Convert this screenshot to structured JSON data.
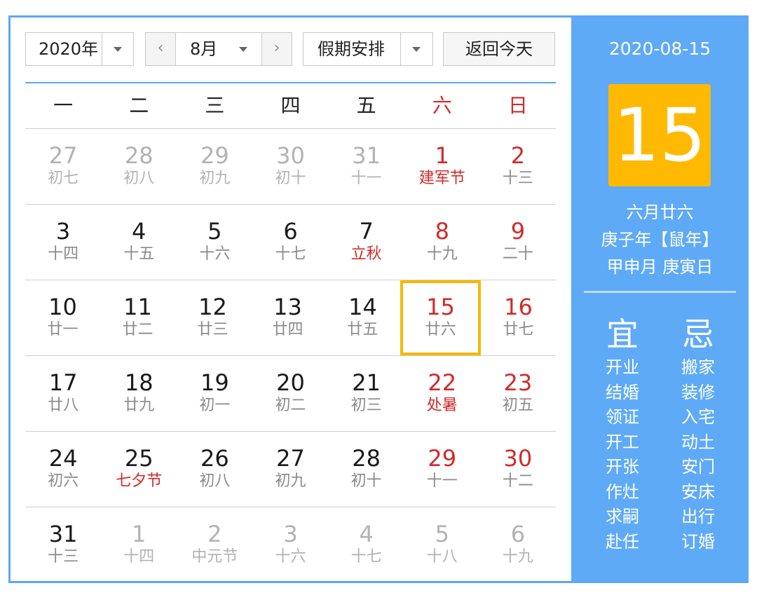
{
  "toolbar": {
    "year": "2020年",
    "prev_icon": "‹",
    "month": "8月",
    "next_icon": "›",
    "holiday": "假期安排",
    "today_button": "返回今天"
  },
  "weekdays": [
    "一",
    "二",
    "三",
    "四",
    "五",
    "六",
    "日"
  ],
  "weeks": [
    [
      {
        "day": "27",
        "lunar": "初七",
        "other": true
      },
      {
        "day": "28",
        "lunar": "初八",
        "other": true
      },
      {
        "day": "29",
        "lunar": "初九",
        "other": true
      },
      {
        "day": "30",
        "lunar": "初十",
        "other": true
      },
      {
        "day": "31",
        "lunar": "十一",
        "other": true
      },
      {
        "day": "1",
        "lunar": "建军节",
        "weekend": true,
        "festival": true
      },
      {
        "day": "2",
        "lunar": "十三",
        "weekend": true
      }
    ],
    [
      {
        "day": "3",
        "lunar": "十四"
      },
      {
        "day": "4",
        "lunar": "十五"
      },
      {
        "day": "5",
        "lunar": "十六"
      },
      {
        "day": "6",
        "lunar": "十七"
      },
      {
        "day": "7",
        "lunar": "立秋",
        "festival": true
      },
      {
        "day": "8",
        "lunar": "十九",
        "weekend": true
      },
      {
        "day": "9",
        "lunar": "二十",
        "weekend": true
      }
    ],
    [
      {
        "day": "10",
        "lunar": "廿一"
      },
      {
        "day": "11",
        "lunar": "廿二"
      },
      {
        "day": "12",
        "lunar": "廿三"
      },
      {
        "day": "13",
        "lunar": "廿四"
      },
      {
        "day": "14",
        "lunar": "廿五"
      },
      {
        "day": "15",
        "lunar": "廿六",
        "weekend": true,
        "selected": true
      },
      {
        "day": "16",
        "lunar": "廿七",
        "weekend": true
      }
    ],
    [
      {
        "day": "17",
        "lunar": "廿八"
      },
      {
        "day": "18",
        "lunar": "廿九"
      },
      {
        "day": "19",
        "lunar": "初一"
      },
      {
        "day": "20",
        "lunar": "初二"
      },
      {
        "day": "21",
        "lunar": "初三"
      },
      {
        "day": "22",
        "lunar": "处暑",
        "weekend": true,
        "festival": true
      },
      {
        "day": "23",
        "lunar": "初五",
        "weekend": true
      }
    ],
    [
      {
        "day": "24",
        "lunar": "初六"
      },
      {
        "day": "25",
        "lunar": "七夕节",
        "festival": true
      },
      {
        "day": "26",
        "lunar": "初八"
      },
      {
        "day": "27",
        "lunar": "初九"
      },
      {
        "day": "28",
        "lunar": "初十"
      },
      {
        "day": "29",
        "lunar": "十一",
        "weekend": true
      },
      {
        "day": "30",
        "lunar": "十二",
        "weekend": true
      }
    ],
    [
      {
        "day": "31",
        "lunar": "十三"
      },
      {
        "day": "1",
        "lunar": "十四",
        "other": true
      },
      {
        "day": "2",
        "lunar": "中元节",
        "other": true
      },
      {
        "day": "3",
        "lunar": "十六",
        "other": true
      },
      {
        "day": "4",
        "lunar": "十七",
        "other": true
      },
      {
        "day": "5",
        "lunar": "十八",
        "other": true
      },
      {
        "day": "6",
        "lunar": "十九",
        "other": true
      }
    ]
  ],
  "panel": {
    "date": "2020-08-15",
    "big_day": "15",
    "lunar_date": "六月廿六",
    "ganzhi_year": "庚子年【鼠年】",
    "ganzhi_month_day": "甲申月 庚寅日",
    "yi_title": "宜",
    "ji_title": "忌",
    "yi": [
      "开业",
      "结婚",
      "领证",
      "开工",
      "开张",
      "作灶",
      "求嗣",
      "赴任"
    ],
    "ji": [
      "搬家",
      "装修",
      "入宅",
      "动土",
      "安门",
      "安床",
      "出行",
      "订婚"
    ]
  },
  "colors": {
    "accent_blue": "#5eaaf6",
    "highlight": "#ffb900",
    "weekend_red": "#d22a2a"
  }
}
